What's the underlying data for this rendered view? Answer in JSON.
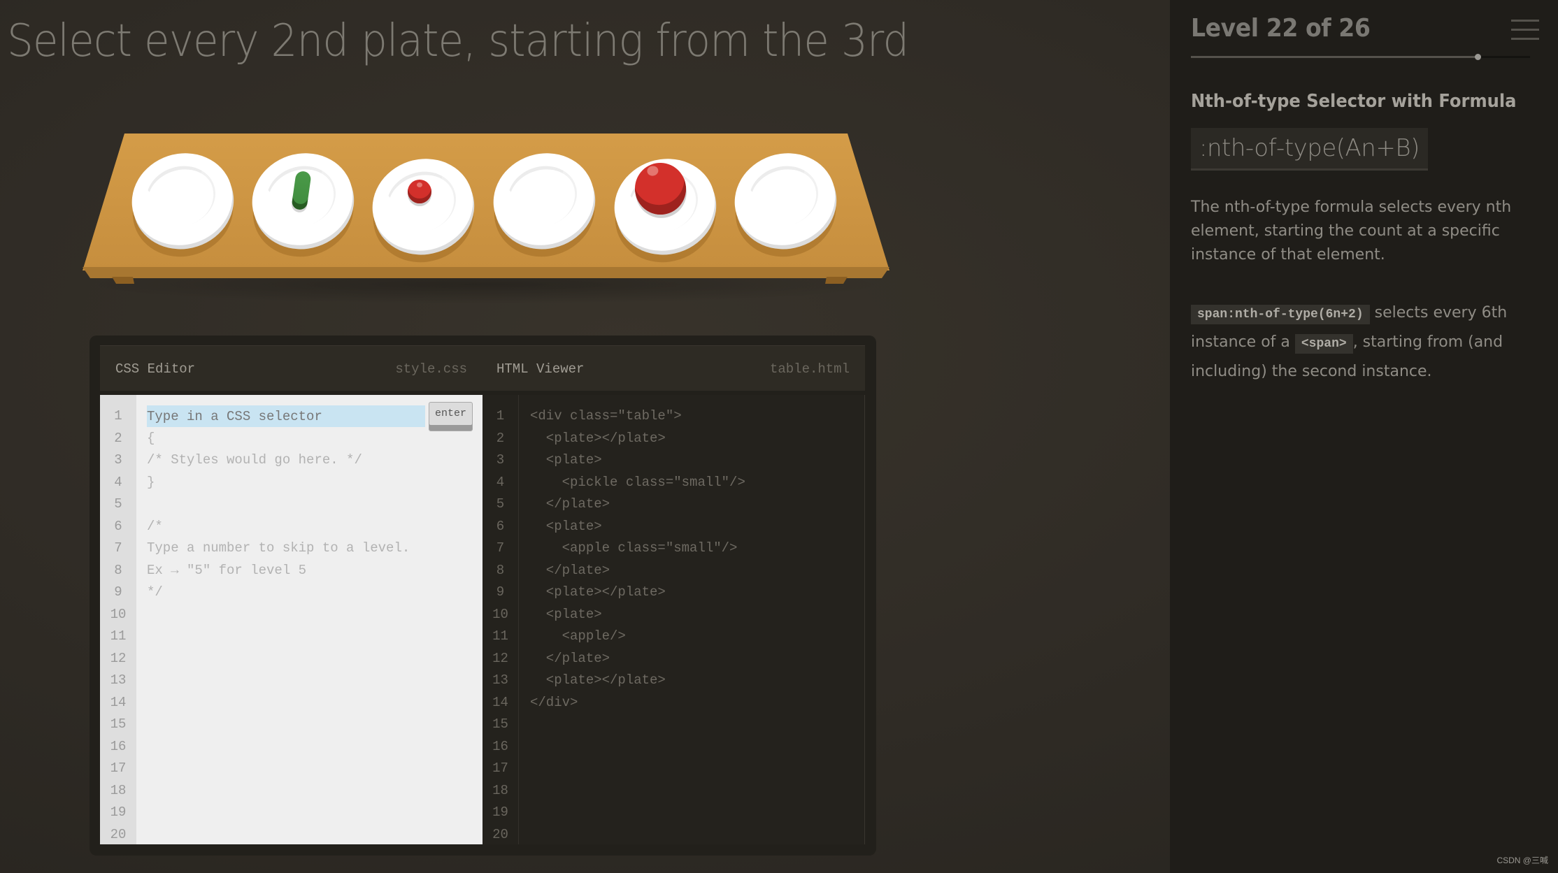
{
  "game": {
    "order_text": "Select every 2nd plate, starting from the 3rd",
    "table_items": [
      {
        "type": "plate",
        "contents": null
      },
      {
        "type": "plate",
        "contents": "pickle small"
      },
      {
        "type": "plate",
        "contents": "apple small"
      },
      {
        "type": "plate",
        "contents": null
      },
      {
        "type": "plate",
        "contents": "apple"
      },
      {
        "type": "plate",
        "contents": null
      }
    ]
  },
  "css_editor": {
    "title": "CSS Editor",
    "filename": "style.css",
    "input_placeholder": "Type in a CSS selector",
    "input_value": "",
    "enter_label": "enter",
    "line_numbers": [
      "1",
      "2",
      "3",
      "4",
      "5",
      "6",
      "7",
      "8",
      "9",
      "10",
      "11",
      "12",
      "13",
      "14",
      "15",
      "16",
      "17",
      "18",
      "19",
      "20"
    ],
    "lines": [
      "",
      "{",
      "/* Styles would go here. */",
      "}",
      "",
      "/*",
      "Type a number to skip to a level.",
      "Ex → \"5\" for level 5",
      "*/"
    ]
  },
  "html_viewer": {
    "title": "HTML Viewer",
    "filename": "table.html",
    "line_numbers": [
      "1",
      "2",
      "3",
      "4",
      "5",
      "6",
      "7",
      "8",
      "9",
      "10",
      "11",
      "12",
      "13",
      "14",
      "15",
      "16",
      "17",
      "18",
      "19",
      "20"
    ],
    "lines": [
      "<div class=\"table\">",
      "  <plate></plate>",
      "  <plate>",
      "    <pickle class=\"small\"/>",
      "  </plate>",
      "  <plate>",
      "    <apple class=\"small\"/>",
      "  </plate>",
      "  <plate></plate>",
      "  <plate>",
      "    <apple/>",
      "  </plate>",
      "  <plate></plate>",
      "</div>"
    ]
  },
  "sidebar": {
    "level_text": "Level 22 of 26",
    "level_current": 22,
    "level_total": 26,
    "progress_fraction": 0.846,
    "selector_name": "Nth-of-type Selector with Formula",
    "syntax": ":nth-of-type(An+B)",
    "hint": "The nth-of-type formula selects every nth element, starting the count at a specific instance of that element.",
    "example": {
      "code1": "span:nth-of-type(6n+2)",
      "text1": " selects every 6th instance of a ",
      "code2": "<span>",
      "text2": ", starting from (and including) the second instance."
    }
  },
  "watermark": "CSDN @三喊"
}
